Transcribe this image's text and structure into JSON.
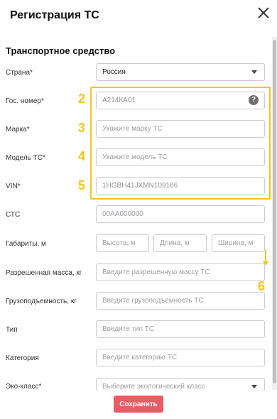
{
  "modal": {
    "title": "Регистрация ТС"
  },
  "section": {
    "title": "Транспортное средство"
  },
  "fields": {
    "country": {
      "label": "Страна*",
      "value": "Россия"
    },
    "plate": {
      "label": "Гос. номер*",
      "value": "А214КА01"
    },
    "brand": {
      "label": "Марка*",
      "placeholder": "Укажите марку ТС"
    },
    "model": {
      "label": "Модель ТС*",
      "placeholder": "Укажите модель ТС"
    },
    "vin": {
      "label": "VIN*",
      "value": "1HGBH41JXMN109186"
    },
    "sts": {
      "label": "СТС",
      "placeholder": "00АА000000"
    },
    "dimensions": {
      "label": "Габариты, м",
      "height_placeholder": "Высота, м",
      "length_placeholder": "Длина, м",
      "width_placeholder": "Ширина, м"
    },
    "allowed_mass": {
      "label": "Разрешенная масса, кг",
      "placeholder": "Введите разрешенную массу ТС"
    },
    "capacity": {
      "label": "Грузоподъемность, кг",
      "placeholder": "Введите грузоподъемность ТС"
    },
    "type": {
      "label": "Тип",
      "placeholder": "Введите тип ТС"
    },
    "category": {
      "label": "Категория",
      "placeholder": "Введите категорию ТС"
    },
    "eco_class": {
      "label": "Эко-класс*",
      "placeholder": "Выберите экологический класс"
    }
  },
  "annotations": {
    "n2": "2",
    "n3": "3",
    "n4": "4",
    "n5": "5",
    "n6": "6"
  },
  "footer": {
    "save_label": "Сохранить"
  },
  "colors": {
    "accent": "#ea5b64",
    "annotation": "#f5c518"
  },
  "icons": {
    "close": "close-icon",
    "help": "help-icon",
    "dropdown": "chevron-down-icon"
  }
}
